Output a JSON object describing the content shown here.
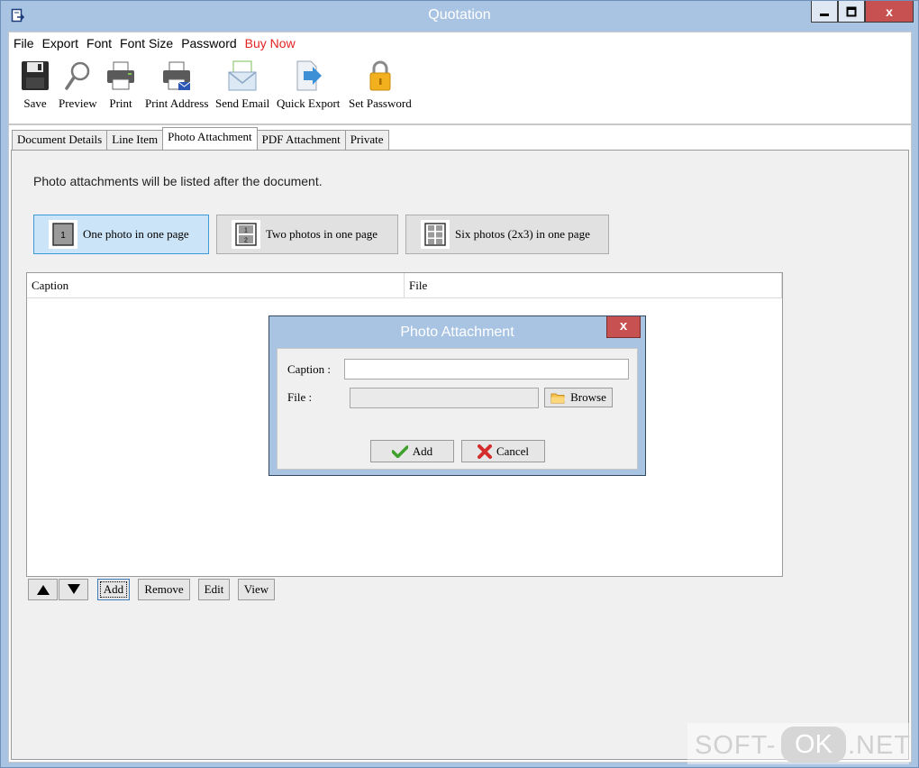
{
  "window": {
    "title": "Quotation",
    "icons": {
      "app": "document-export-icon",
      "minimize": "minimize-icon",
      "maximize": "maximize-icon",
      "close": "close-icon"
    },
    "close_glyph": "x"
  },
  "menu": {
    "items": [
      "File",
      "Export",
      "Font",
      "Font Size",
      "Password",
      "Buy Now"
    ],
    "buy_color": "#e32222"
  },
  "toolbar": {
    "items": [
      {
        "label": "Save",
        "icon": "save-icon"
      },
      {
        "label": "Preview",
        "icon": "magnifier-icon"
      },
      {
        "label": "Print",
        "icon": "printer-icon"
      },
      {
        "label": "Print Address",
        "icon": "print-address-icon"
      },
      {
        "label": "Send Email",
        "icon": "email-icon"
      },
      {
        "label": "Quick Export",
        "icon": "export-icon"
      },
      {
        "label": "Set Password",
        "icon": "lock-icon"
      }
    ]
  },
  "tabs": {
    "items": [
      "Document Details",
      "Line Item",
      "Photo Attachment",
      "PDF Attachment",
      "Private"
    ],
    "active": "Photo Attachment"
  },
  "panel": {
    "info_text": "Photo attachments will be listed after the document.",
    "layouts": [
      {
        "label": "One photo in one page",
        "icon": "one-photo-layout-icon",
        "tile_text": "1",
        "selected": true
      },
      {
        "label": "Two photos in one page",
        "icon": "two-photo-layout-icon",
        "tile_text": "1 2",
        "selected": false
      },
      {
        "label": "Six photos (2x3) in one page",
        "icon": "six-photo-layout-icon",
        "tile_text": "1 2 3 4 5 6",
        "selected": false
      }
    ],
    "grid_columns": [
      "Caption",
      "File"
    ],
    "rows": [],
    "buttons": {
      "up_icon": "arrow-up-icon",
      "down_icon": "arrow-down-icon",
      "add": "Add",
      "remove": "Remove",
      "edit": "Edit",
      "view": "View"
    }
  },
  "dialog": {
    "title": "Photo Attachment",
    "close_glyph": "x",
    "caption_label": "Caption :",
    "caption_value": "",
    "file_label": "File :",
    "file_value": "",
    "browse_label": "Browse",
    "browse_icon": "folder-icon",
    "add_label": "Add",
    "add_icon": "checkmark-icon",
    "cancel_label": "Cancel",
    "cancel_icon": "red-x-icon"
  },
  "watermark": {
    "left": "SOFT-",
    "pill": "OK",
    "right": ".NET"
  }
}
